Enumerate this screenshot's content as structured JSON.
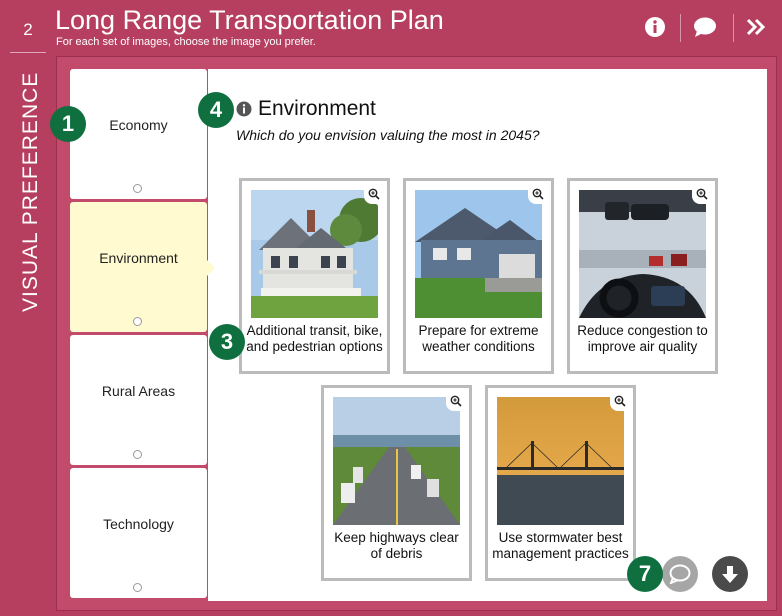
{
  "header": {
    "step_number": "2",
    "title": "Long Range Transportation Plan",
    "subtitle": "For each set of images, choose the image you prefer."
  },
  "side_label": "VISUAL PREFERENCE",
  "tabs": [
    {
      "label": "Economy"
    },
    {
      "label": "Environment"
    },
    {
      "label": "Rural Areas"
    },
    {
      "label": "Technology"
    }
  ],
  "section": {
    "title": "Environment",
    "question": "Which do you envision valuing the most in 2045?"
  },
  "cards": [
    {
      "caption": "Additional transit, bike, and pedestrian options"
    },
    {
      "caption": "Prepare for extreme weather conditions"
    },
    {
      "caption": "Reduce congestion to improve air quality"
    },
    {
      "caption": "Keep highways clear of debris"
    },
    {
      "caption": "Use stormwater best management practices"
    }
  ],
  "badges": {
    "b1": "1",
    "b3": "3",
    "b4": "4",
    "b7": "7"
  },
  "icons": {
    "header": [
      "info-icon",
      "comment-icon",
      "double-chevron-right-icon"
    ],
    "bottom": [
      "comment-icon",
      "arrow-down-icon"
    ]
  },
  "colors": {
    "brand": "#b63f5f",
    "active_tab": "#fffad0",
    "badge": "#0f6f3f"
  }
}
